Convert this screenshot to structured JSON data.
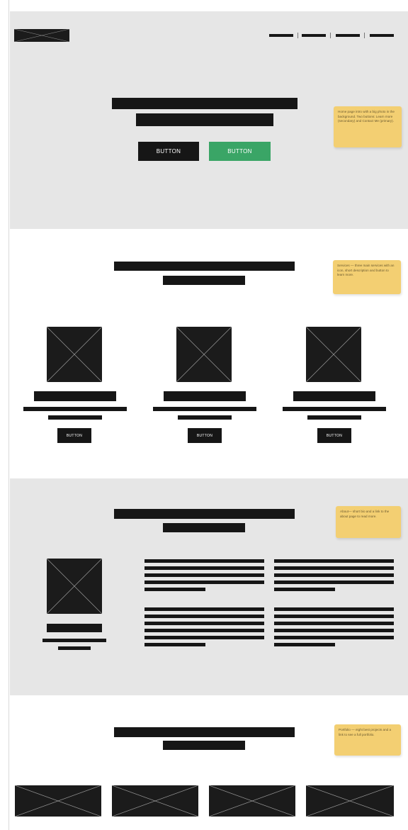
{
  "hero": {
    "primary_button": "BUTTON",
    "secondary_button": "BUTTON",
    "note": "Home page intro with a big photo in the background. Two buttons: Learn more (secondary) and Contact Me (primary).",
    "colors": {
      "secondary_button": "#3aa566"
    }
  },
  "services": {
    "note": "Services — three main services with an icon, short description and button to learn more.",
    "cards": [
      {
        "button": "BUTTON"
      },
      {
        "button": "BUTTON"
      },
      {
        "button": "BUTTON"
      }
    ]
  },
  "about": {
    "note": "About— short bio and a link to the about page to read more."
  },
  "portfolio": {
    "note": "Portfolio — eight best projects and a link to see a full portfolio."
  },
  "colors": {
    "block": "#161616",
    "gray_section": "#e6e6e6",
    "sticky_note": "#f3cf72"
  }
}
